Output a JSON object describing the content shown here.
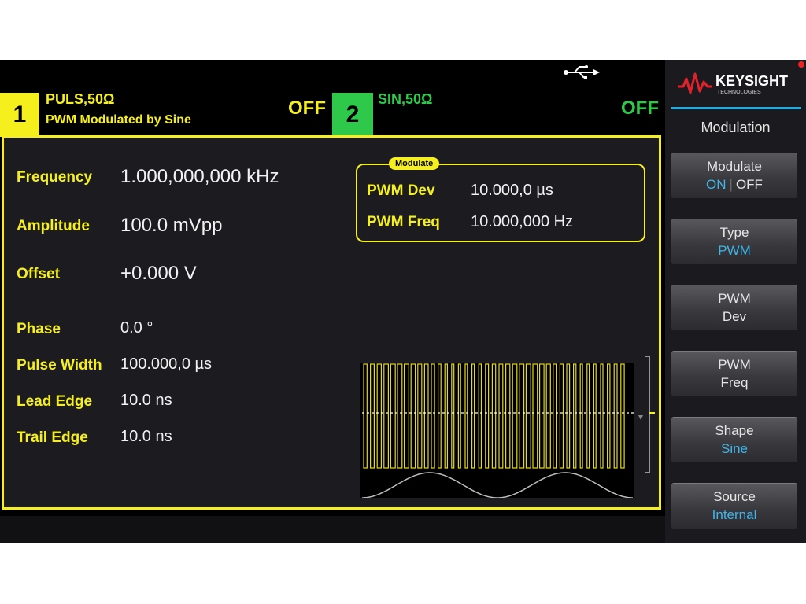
{
  "status": {
    "usb_icon": "usb-icon"
  },
  "channels": [
    {
      "number": "1",
      "function": "PULS,50Ω",
      "mode": "PWM Modulated by Sine",
      "output": "OFF",
      "color": "#f5ef1e"
    },
    {
      "number": "2",
      "function": "SIN,50Ω",
      "mode": "",
      "output": "OFF",
      "color": "#2ec94a"
    }
  ],
  "params": [
    {
      "label": "Frequency",
      "value": "1.000,000,000 kHz"
    },
    {
      "label": "Amplitude",
      "value": "100.0 mVpp"
    },
    {
      "label": "Offset",
      "value": "+0.000 V"
    },
    {
      "label": "Phase",
      "value": "0.0 °"
    },
    {
      "label": "Pulse Width",
      "value": "100.000,0 µs"
    },
    {
      "label": "Lead Edge",
      "value": "10.0 ns"
    },
    {
      "label": "Trail Edge",
      "value": "10.0 ns"
    }
  ],
  "modulate_box": {
    "title": "Modulate",
    "rows": [
      {
        "label": "PWM Dev",
        "value": "10.000,0 µs"
      },
      {
        "label": "PWM Freq",
        "value": "10.000,000 Hz"
      }
    ]
  },
  "brand": {
    "name": "KEYSIGHT",
    "sub": "TECHNOLOGIES"
  },
  "menu": {
    "title": "Modulation",
    "softkeys": [
      {
        "label": "Modulate",
        "sub_on": "ON",
        "sub_off": "OFF"
      },
      {
        "label": "Type",
        "sub": "PWM"
      },
      {
        "label": "PWM",
        "sub2": "Dev"
      },
      {
        "label": "PWM",
        "sub2": "Freq"
      },
      {
        "label": "Shape",
        "sub": "Sine"
      },
      {
        "label": "Source",
        "sub": "Internal"
      }
    ]
  },
  "colors": {
    "accent": "#f5ef1e",
    "channel2": "#2ec94a",
    "softkey_highlight": "#3fb6ea",
    "brand_red": "#e3212b"
  }
}
